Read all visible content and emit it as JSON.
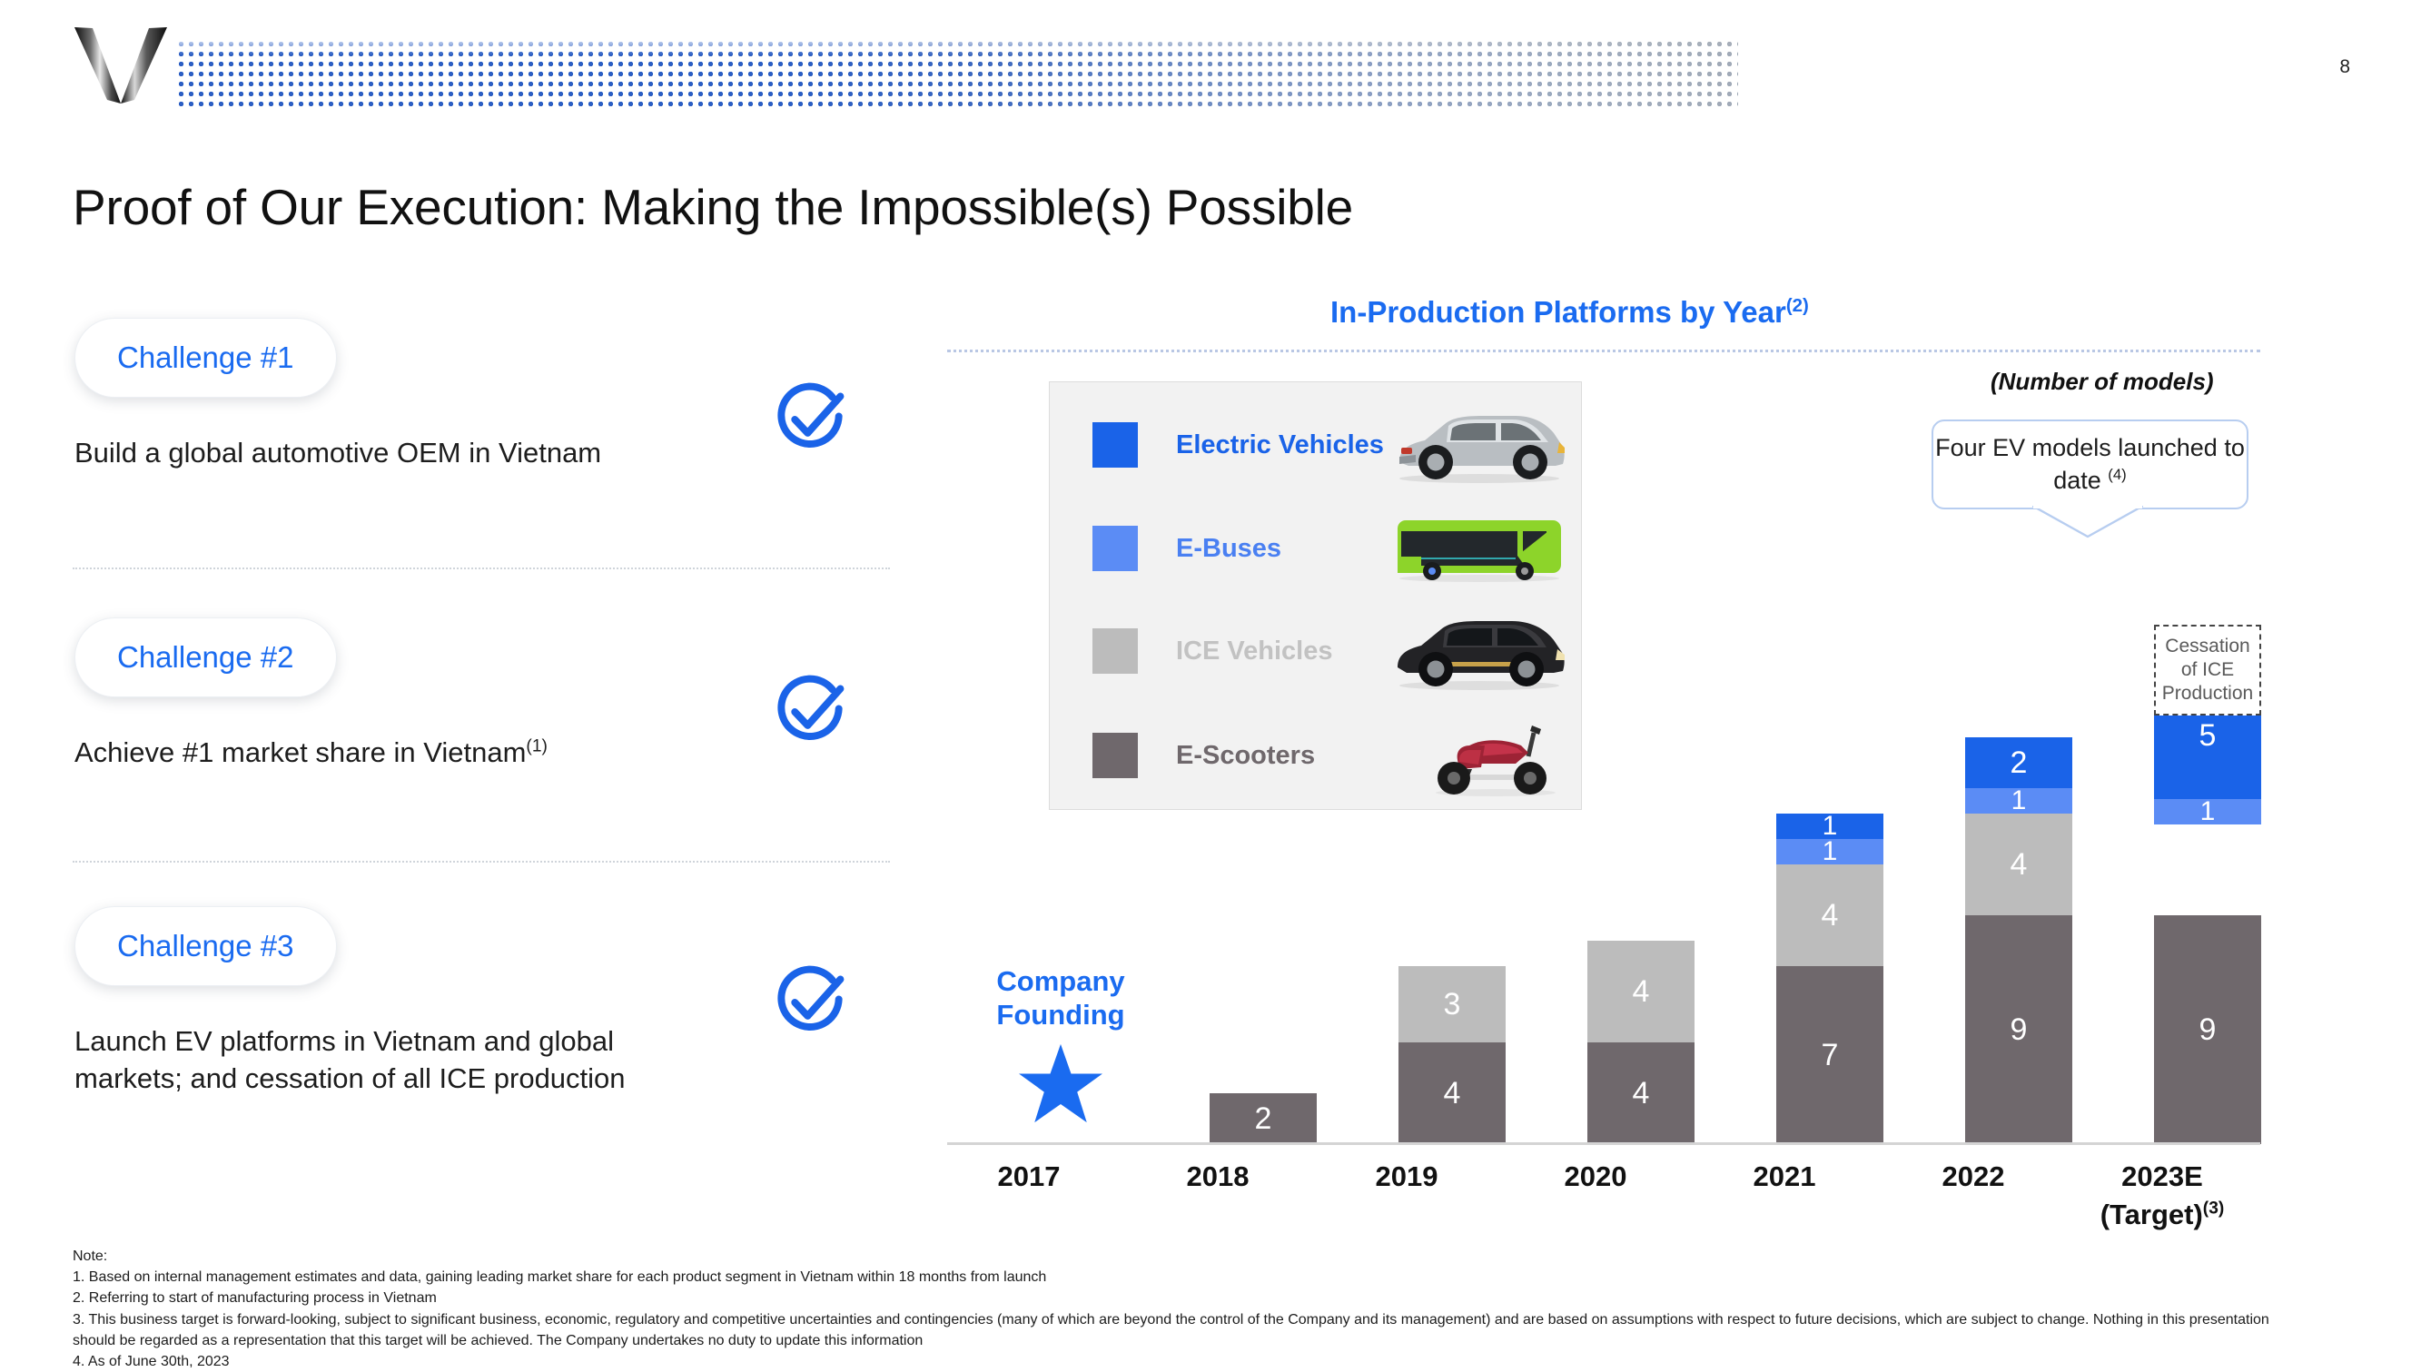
{
  "header": {
    "page_number": "8",
    "logo_name": "vinfast-v-logo"
  },
  "page_title": "Proof of Our Execution: Making the Impossible(s) Possible",
  "challenges": [
    {
      "pill_label": "Challenge #1",
      "description": "Build a global automotive OEM in Vietnam",
      "description_sup": "",
      "status_icon": "check-circle-icon"
    },
    {
      "pill_label": "Challenge #2",
      "description": "Achieve #1 market share in Vietnam",
      "description_sup": "(1)",
      "status_icon": "check-circle-icon"
    },
    {
      "pill_label": "Challenge #3",
      "description": "Launch EV platforms in Vietnam and global markets; and cessation of all ICE production",
      "description_sup": "",
      "status_icon": "check-circle-icon"
    }
  ],
  "chart_panel": {
    "title": "In-Production Platforms by Year",
    "title_sup": "(2)",
    "units_label": "(Number of models)",
    "founding_label_line1": "Company",
    "founding_label_line2": "Founding",
    "founding_icon": "star-icon",
    "callout": "Four EV models launched to date ",
    "callout_sup": "(4)",
    "cessation_box": "Cessation of ICE Production"
  },
  "legend": [
    {
      "label": "Electric Vehicles",
      "color": "#1a63e8",
      "text_color": "#1a63e8",
      "image": "ev-suv-image"
    },
    {
      "label": "E-Buses",
      "color": "#5b8cf5",
      "text_color": "#4a80f2",
      "image": "e-bus-image"
    },
    {
      "label": "ICE Vehicles",
      "color": "#bcbcbc",
      "text_color": "#c2c2c2",
      "image": "ice-suv-image"
    },
    {
      "label": "E-Scooters",
      "color": "#6f686c",
      "text_color": "#6f686c",
      "image": "e-scooter-image"
    }
  ],
  "chart_data": {
    "type": "bar",
    "subtype": "stacked",
    "title": "In-Production Platforms by Year",
    "ylabel": "(Number of models)",
    "xlabel": "",
    "categories": [
      "2017",
      "2018",
      "2019",
      "2020",
      "2021",
      "2022",
      "2023E (Target)"
    ],
    "category_labels": [
      {
        "main": "2017",
        "sub": "",
        "sup": ""
      },
      {
        "main": "2018",
        "sub": "",
        "sup": ""
      },
      {
        "main": "2019",
        "sub": "",
        "sup": ""
      },
      {
        "main": "2020",
        "sub": "",
        "sup": ""
      },
      {
        "main": "2021",
        "sub": "",
        "sup": ""
      },
      {
        "main": "2022",
        "sub": "",
        "sup": ""
      },
      {
        "main": "2023E",
        "sub": "(Target)",
        "sup": "(3)"
      }
    ],
    "series": [
      {
        "name": "E-Scooters",
        "color": "#6f686c",
        "values": [
          0,
          2,
          4,
          4,
          7,
          9,
          9
        ]
      },
      {
        "name": "ICE Vehicles",
        "color": "#bcbcbc",
        "values": [
          0,
          0,
          3,
          4,
          4,
          4,
          0
        ]
      },
      {
        "name": "E-Buses",
        "color": "#5b8cf5",
        "values": [
          0,
          0,
          0,
          0,
          1,
          1,
          1
        ]
      },
      {
        "name": "Electric Vehicles",
        "color": "#1a63e8",
        "values": [
          0,
          0,
          0,
          0,
          1,
          2,
          5
        ]
      }
    ],
    "totals": [
      0,
      2,
      7,
      8,
      13,
      16,
      15
    ],
    "ylim": [
      0,
      16
    ],
    "grid": false,
    "legend_position": "inside-left-box",
    "annotations": [
      {
        "text": "Company Founding",
        "at": "2017"
      },
      {
        "text": "Four EV models launched to date (4)",
        "at": "2023E"
      },
      {
        "text": "Cessation of ICE Production",
        "at": "2023E"
      }
    ]
  },
  "notes": {
    "heading": "Note:",
    "items": [
      "1.  Based on internal management estimates and data, gaining leading market share for each product segment in Vietnam within 18 months from launch",
      "2.  Referring to start of manufacturing process in Vietnam",
      "3.  This business target is forward-looking, subject to significant business, economic, regulatory and competitive uncertainties and contingencies (many of which are beyond the control of the Company and its management) and are based on assumptions with respect to future decisions, which are subject to change. Nothing in this presentation should be regarded as a representation that this target will be achieved. The Company undertakes no duty to update this information",
      "4.  As of June 30th, 2023"
    ]
  },
  "colors": {
    "brand_blue": "#1a6bf0",
    "ev_blue": "#1a63e8",
    "bus_blue": "#5b8cf5",
    "ice_gray": "#bcbcbc",
    "scooter_gray": "#6f686c"
  }
}
